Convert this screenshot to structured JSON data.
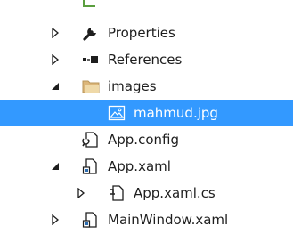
{
  "tree": {
    "items": [
      {
        "label": "Properties",
        "icon": "wrench-icon",
        "expander": "collapsed"
      },
      {
        "label": "References",
        "icon": "references-icon",
        "expander": "collapsed"
      },
      {
        "label": "images",
        "icon": "folder-icon",
        "expander": "expanded"
      },
      {
        "label": "mahmud.jpg",
        "icon": "image-file-icon",
        "expander": "none",
        "selected": true
      },
      {
        "label": "App.config",
        "icon": "config-file-icon",
        "expander": "none"
      },
      {
        "label": "App.xaml",
        "icon": "xaml-file-icon",
        "expander": "expanded"
      },
      {
        "label": "App.xaml.cs",
        "icon": "csharp-file-icon",
        "expander": "collapsed"
      },
      {
        "label": "MainWindow.xaml",
        "icon": "xaml-file-icon",
        "expander": "collapsed"
      }
    ]
  },
  "colors": {
    "selection": "#3399ff",
    "text": "#1e1e1e",
    "folder": "#dcb67a",
    "accent_green": "#5a9e3e"
  }
}
